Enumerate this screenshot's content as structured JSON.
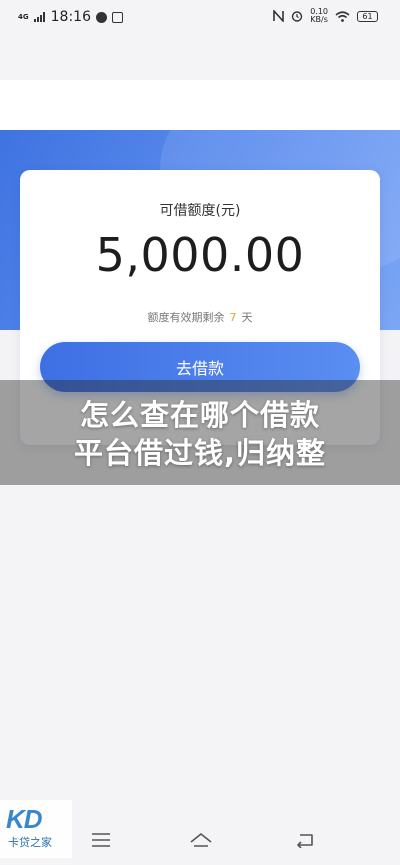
{
  "status_bar": {
    "time": "18:16",
    "signal_label": "4G",
    "net_speed_value": "0.10",
    "net_speed_unit": "KB/s",
    "battery": "61"
  },
  "card": {
    "label": "可借额度(元)",
    "amount": "5,000.00",
    "validity_prefix": "额度有效期剩余",
    "validity_days": "7",
    "validity_suffix": "天"
  },
  "actions": {
    "borrow_label": "去借款"
  },
  "overlay": {
    "line1": "怎么查在哪个借款",
    "line2": "平台借过钱,归纳整"
  },
  "watermark": {
    "logo": "KD",
    "text": "卡贷之家"
  },
  "colors": {
    "primary_blue": "#3e6fe4",
    "days_accent": "#e6a23c"
  },
  "icons": {
    "nav_menu": "menu-icon",
    "nav_home": "home-icon",
    "nav_back": "back-icon"
  }
}
